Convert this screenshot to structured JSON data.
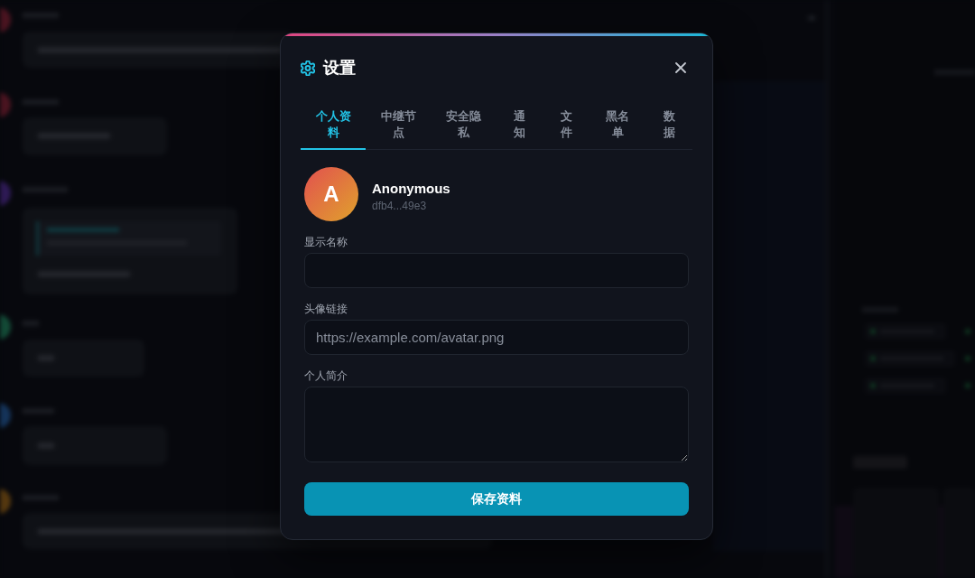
{
  "dialog": {
    "title": "设置",
    "tabs": [
      {
        "label": "个人资料",
        "selected": true
      },
      {
        "label": "中继节点",
        "selected": false
      },
      {
        "label": "安全隐私",
        "selected": false
      },
      {
        "label": "通知",
        "selected": false
      },
      {
        "label": "文件",
        "selected": false
      },
      {
        "label": "黑名单",
        "selected": false
      },
      {
        "label": "数据",
        "selected": false
      }
    ],
    "profile": {
      "avatar_letter": "A",
      "name": "Anonymous",
      "pubkey": "dfb4...49e3"
    },
    "fields": [
      {
        "kind": "input",
        "label": "显示名称"
      },
      {
        "kind": "input",
        "label": "头像链接",
        "placeholder": "https://example.com/avatar.png"
      },
      {
        "kind": "textarea",
        "label": "个人简介"
      }
    ],
    "save_button": "保存资料"
  }
}
